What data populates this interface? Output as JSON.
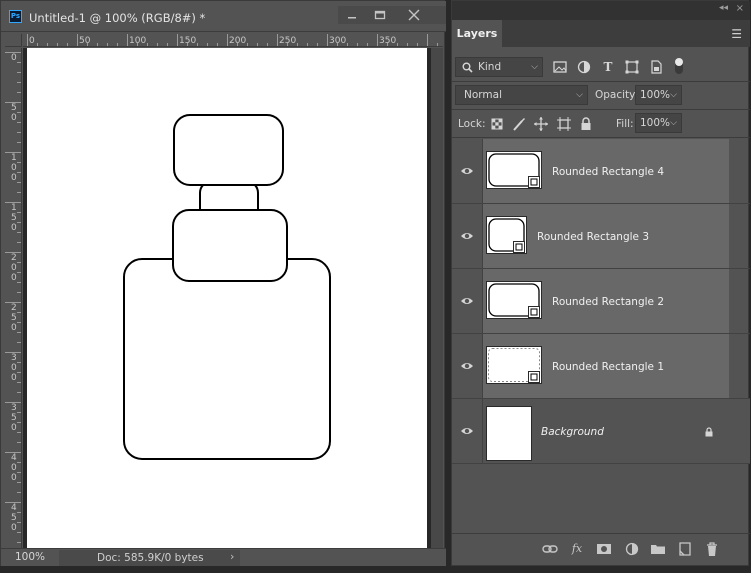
{
  "document": {
    "title": "Untitled-1 @ 100% (RGB/8#) *",
    "app_icon": "Ps",
    "zoom": "100%",
    "doc_size": "Doc: 585.9K/0 bytes",
    "ruler_top_ticks": [
      "0",
      "50",
      "100",
      "150",
      "200",
      "250",
      "300",
      "350"
    ],
    "ruler_left_ticks": [
      "0",
      "50",
      "100",
      "150",
      "200",
      "250",
      "300",
      "350",
      "400",
      "450"
    ]
  },
  "layers_panel": {
    "tab": "Layers",
    "filter": "Kind",
    "blend_mode": "Normal",
    "opacity_label": "Opacity:",
    "opacity_value": "100%",
    "lock_label": "Lock:",
    "fill_label": "Fill:",
    "fill_value": "100%",
    "layers": [
      {
        "name": "Rounded Rectangle 4",
        "visible": true,
        "selected": true
      },
      {
        "name": "Rounded Rectangle 3",
        "visible": true,
        "selected": true
      },
      {
        "name": "Rounded Rectangle 2",
        "visible": true,
        "selected": true
      },
      {
        "name": "Rounded Rectangle 1",
        "visible": true,
        "selected": true
      },
      {
        "name": "Background",
        "visible": true,
        "selected": false,
        "locked": true
      }
    ]
  },
  "colors": {
    "panel_bg": "#535353",
    "selected_layer": "#686868",
    "app_bg": "#282828",
    "accent": "#31a8ff"
  },
  "icons": {
    "filter_icons": [
      "image-filter-icon",
      "adjustment-filter-icon",
      "type-filter-icon",
      "shape-filter-icon",
      "smart-object-filter-icon",
      "filter-toggle-icon"
    ],
    "lock_icons": [
      "lock-transparent-icon",
      "lock-image-icon",
      "lock-position-icon",
      "lock-artboard-icon",
      "lock-all-icon"
    ],
    "footer_icons": [
      "link-layers-icon",
      "fx-icon",
      "add-mask-icon",
      "new-adjustment-icon",
      "new-group-icon",
      "new-layer-icon",
      "delete-layer-icon"
    ]
  }
}
